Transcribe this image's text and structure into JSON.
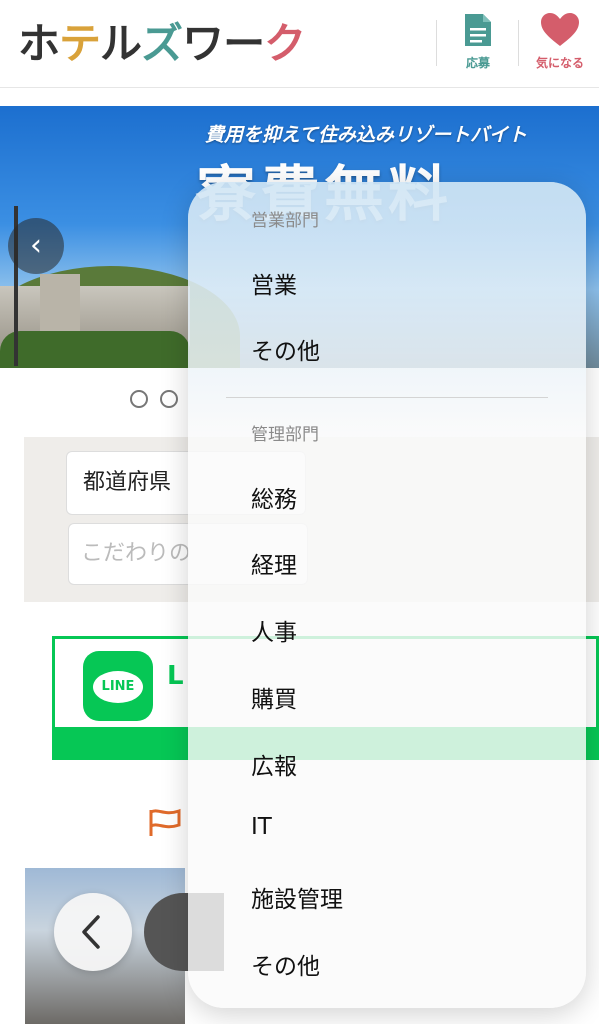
{
  "header": {
    "logo_chars": [
      {
        "ch": "ホ",
        "color": "#333333"
      },
      {
        "ch": "テ",
        "color": "#d9a23a"
      },
      {
        "ch": "ル",
        "color": "#333333"
      },
      {
        "ch": "ズ",
        "color": "#4a9a93"
      },
      {
        "ch": "ワ",
        "color": "#333333"
      },
      {
        "ch": "ー",
        "color": "#333333"
      },
      {
        "ch": "ク",
        "color": "#d45d6b"
      }
    ],
    "apply_label": "応募",
    "favorite_label": "気になる"
  },
  "hero": {
    "subtitle": "費用を抑えて住み込みリゾートバイト",
    "title": "寮費無料"
  },
  "search": {
    "prefecture": "都道府県",
    "keyword_placeholder": "こだわりの"
  },
  "line_banner": {
    "logo_text": "LINE",
    "title_partial": "L"
  },
  "popup": {
    "groups": [
      {
        "title": "営業部門",
        "options": [
          "営業",
          "その他"
        ]
      },
      {
        "title": "管理部門",
        "options": [
          "総務",
          "経理",
          "人事",
          "購買",
          "広報",
          "IT",
          "施設管理",
          "その他"
        ]
      }
    ]
  },
  "colors": {
    "teal": "#4a9a93",
    "pink": "#d45d6b",
    "line_green": "#06c755",
    "flag_orange": "#e06a2a"
  }
}
